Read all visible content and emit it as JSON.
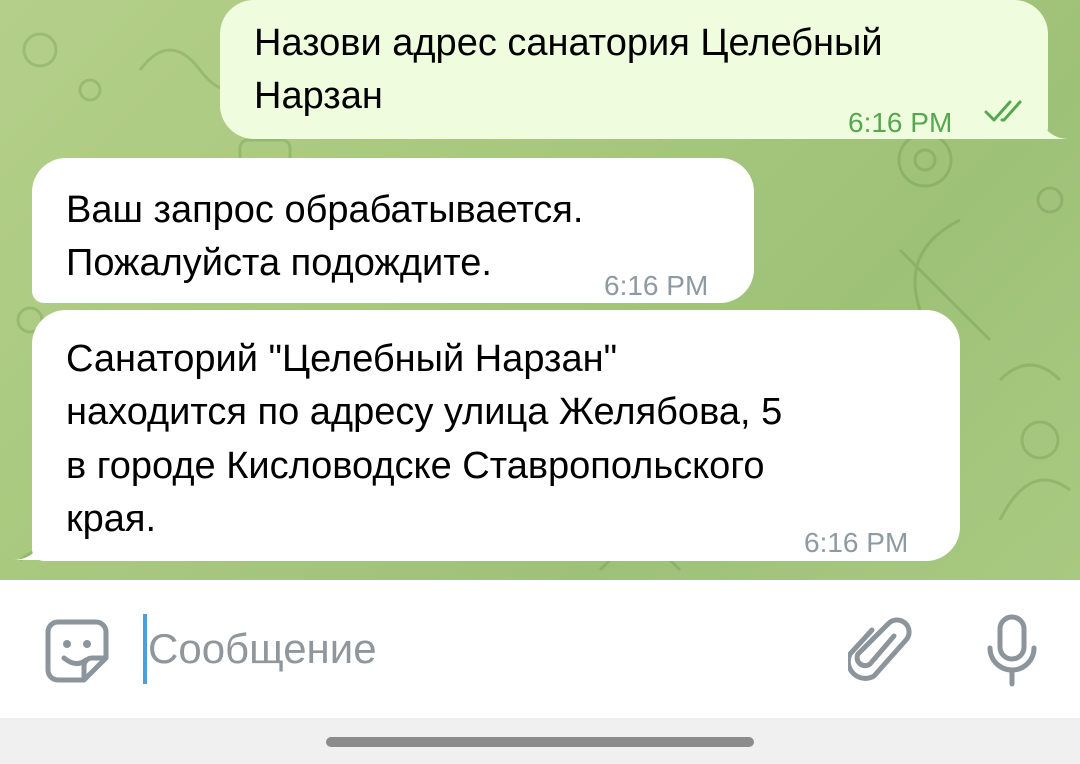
{
  "messages": [
    {
      "direction": "out",
      "text_lines": [
        "Назови адрес санатория Целебный",
        "Нарзан"
      ],
      "time": "6:16 PM",
      "read": true
    },
    {
      "direction": "in",
      "text_lines": [
        "Ваш запрос обрабатывается.",
        "Пожалуйста подождите."
      ],
      "time": "6:16 PM"
    },
    {
      "direction": "in",
      "text_lines": [
        "Санаторий \"Целебный Нарзан\"",
        "находится по адресу улица Желябова, 5",
        "в городе Кисловодске Ставропольского",
        "края."
      ],
      "time": "6:16 PM"
    }
  ],
  "composer": {
    "placeholder": "Сообщение"
  },
  "icons": {
    "left": "sticker-emoji-icon",
    "attach": "paperclip-icon",
    "voice": "microphone-icon"
  },
  "colors": {
    "outgoing_bubble": "#effdde",
    "incoming_bubble": "#ffffff",
    "outgoing_time": "#55a84f",
    "caret": "#4d9ed9"
  }
}
